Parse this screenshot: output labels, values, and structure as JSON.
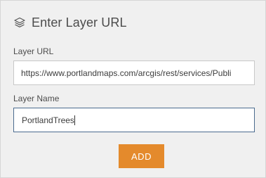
{
  "header": {
    "icon": "layers-icon",
    "title": "Enter Layer URL"
  },
  "form": {
    "url_label": "Layer URL",
    "url_value": "https://www.portlandmaps.com/arcgis/rest/services/Publi",
    "name_label": "Layer Name",
    "name_value": "PortlandTrees",
    "add_label": "ADD"
  },
  "colors": {
    "panel_bg": "#f0f0f0",
    "accent_button": "#e48a2c",
    "focus_border": "#4a6b8f"
  }
}
